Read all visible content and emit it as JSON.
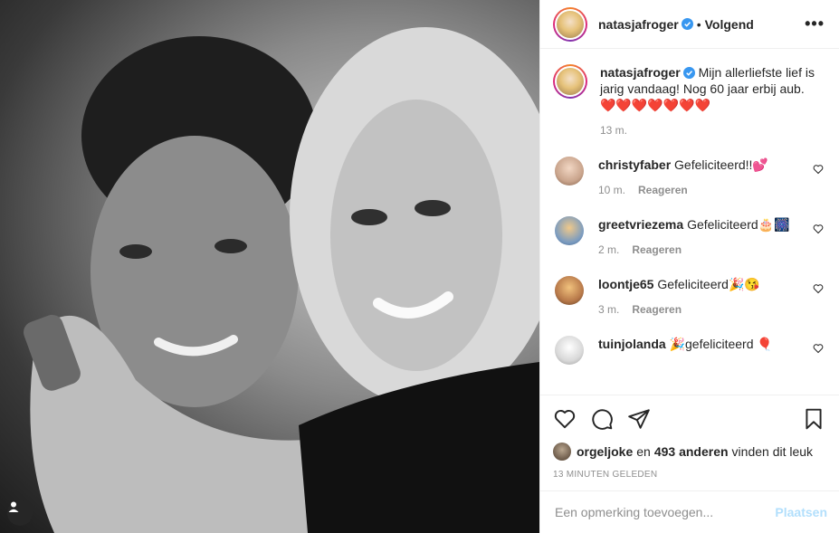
{
  "post": {
    "author": "natasjafroger",
    "follow_dot": "•",
    "follow_label": "Volgend",
    "more_label": "•••"
  },
  "caption": {
    "author": "natasjafroger",
    "text": "Mijn allerliefste lief is jarig vandaag! Nog 60 jaar erbij aub.",
    "hearts": "❤️❤️❤️❤️❤️❤️❤️",
    "time": "13 m."
  },
  "comments": [
    {
      "user": "christyfaber",
      "text": "Gefeliciteerd!!💕",
      "time": "10 m.",
      "reply": "Reageren",
      "avatar_color": "#c9a48c"
    },
    {
      "user": "greetvriezema",
      "text": "Gefeliciteerd🎂🎆",
      "time": "2 m.",
      "reply": "Reageren",
      "avatar_color": "#7a9bc0"
    },
    {
      "user": "loontje65",
      "text": "Gefeliciteerd🎉😘",
      "time": "3 m.",
      "reply": "Reageren",
      "avatar_color": "#b8794a"
    },
    {
      "user": "tuinjolanda",
      "text": "🎉gefeliciteerd 🎈",
      "time": "",
      "reply": "",
      "avatar_color": "#d8d8d8"
    }
  ],
  "likes": {
    "user": "orgeljoke",
    "middle": "en",
    "count": "493 anderen",
    "suffix": "vinden dit leuk"
  },
  "timestamp": "13 minuten geleden",
  "add_comment": {
    "placeholder": "Een opmerking toevoegen...",
    "post_label": "Plaatsen"
  },
  "colors": {
    "verified": "#3897f0",
    "post_button": "#b2dffc",
    "muted": "#8e8e8e"
  },
  "icons": {
    "like": "heart-icon",
    "comment": "comment-icon",
    "share": "paper-plane-icon",
    "save": "bookmark-icon",
    "tag": "user-tag-icon"
  }
}
